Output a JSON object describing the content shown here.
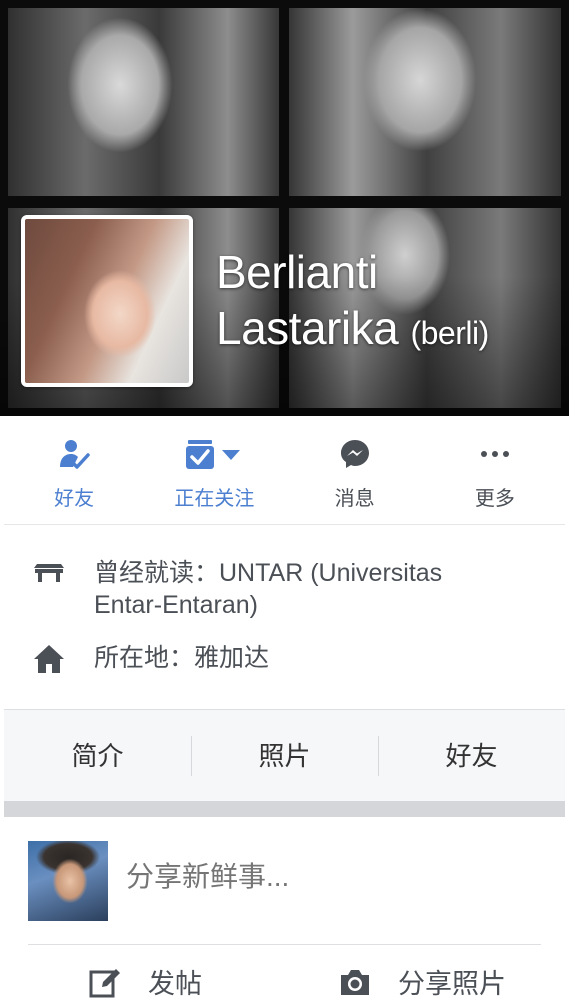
{
  "profile": {
    "name_line1": "Berlianti",
    "name_line2": "Lastarika",
    "nickname": "(berli)"
  },
  "actions": [
    {
      "label": "好友",
      "icon": "friend-check-icon",
      "active": true
    },
    {
      "label": "正在关注",
      "icon": "following-icon",
      "active": true
    },
    {
      "label": "消息",
      "icon": "messenger-icon",
      "active": false
    },
    {
      "label": "更多",
      "icon": "more-icon",
      "active": false
    }
  ],
  "info": {
    "education": "曾经就读：UNTAR (Universitas Entar-Entaran)",
    "location": "所在地：雅加达"
  },
  "tabs": [
    "简介",
    "照片",
    "好友"
  ],
  "composer": {
    "placeholder": "分享新鲜事...",
    "post_label": "发帖",
    "photo_label": "分享照片"
  },
  "colors": {
    "accent": "#4c7fd0",
    "text": "#4b4f56",
    "tabs_bg": "#f6f7f9"
  }
}
